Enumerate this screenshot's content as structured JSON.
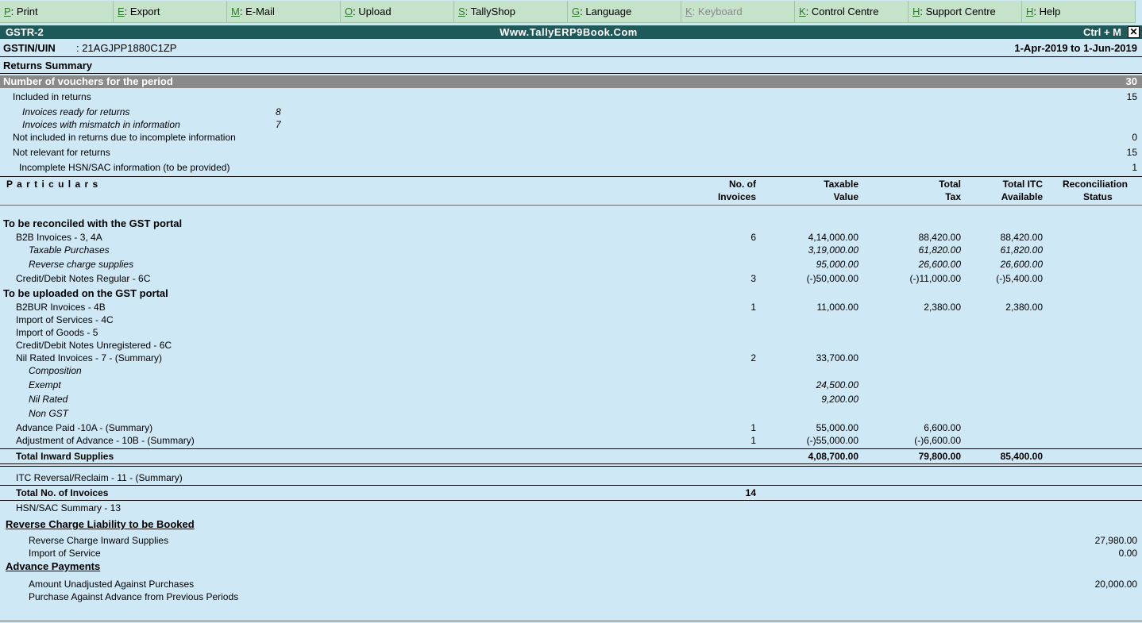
{
  "menu": [
    {
      "key": "P",
      "rest": ": Print",
      "disabled": false
    },
    {
      "key": "E",
      "rest": ": Export",
      "disabled": false
    },
    {
      "key": "M",
      "rest": ": E-Mail",
      "disabled": false
    },
    {
      "key": "O",
      "rest": ": Upload",
      "disabled": false
    },
    {
      "key": "S",
      "rest": ": TallyShop",
      "disabled": false
    },
    {
      "key": "G",
      "rest": ": Language",
      "disabled": false
    },
    {
      "key": "K",
      "rest": ": Keyboard",
      "disabled": true
    },
    {
      "key": "K",
      "rest": ": Control Centre",
      "disabled": false
    },
    {
      "key": "H",
      "rest": ": Support Centre",
      "disabled": false
    },
    {
      "key": "H",
      "rest": ": Help",
      "disabled": false
    }
  ],
  "titlebar": {
    "left": "GSTR-2",
    "center": "Www.TallyERP9Book.Com",
    "right": "Ctrl + M",
    "close": "✕"
  },
  "header": {
    "gstin_label": "GSTIN/UIN",
    "gstin_value": ": 21AGJPP1880C1ZP",
    "period": "1-Apr-2019 to 1-Jun-2019"
  },
  "summary": {
    "title": "Returns Summary",
    "vouchers_label": "Number of vouchers for the period",
    "vouchers_value": "30",
    "included_label": "Included in returns",
    "included_value": "15",
    "ready_label": "Invoices ready for returns",
    "ready_value": "8",
    "mismatch_label": "Invoices with mismatch in information",
    "mismatch_value": "7",
    "notincl_label": "Not included in returns due to incomplete information",
    "notincl_value": "0",
    "notrel_label": "Not relevant for returns",
    "notrel_value": "15",
    "hsn_label": "Incomplete HSN/SAC information (to be provided)",
    "hsn_value": "1"
  },
  "columns": {
    "particulars": "P a r t i c u l a r s",
    "noinv1": "No. of",
    "noinv2": "Invoices",
    "taxable1": "Taxable",
    "taxable2": "Value",
    "tax1": "Total",
    "tax2": "Tax",
    "itc1": "Total ITC",
    "itc2": "Available",
    "rec1": "Reconciliation",
    "rec2": "Status"
  },
  "rows": {
    "sec1": "To be reconciled with the GST portal",
    "b2b": {
      "label": "B2B Invoices - 3, 4A",
      "inv": "6",
      "taxable": "4,14,000.00",
      "tax": "88,420.00",
      "itc": "88,420.00"
    },
    "taxable_purch": {
      "label": "Taxable Purchases",
      "taxable": "3,19,000.00",
      "tax": "61,820.00",
      "itc": "61,820.00"
    },
    "rcm": {
      "label": "Reverse charge supplies",
      "taxable": "95,000.00",
      "tax": "26,600.00",
      "itc": "26,600.00"
    },
    "cdn": {
      "label": "Credit/Debit Notes Regular - 6C",
      "inv": "3",
      "taxable": "(-)50,000.00",
      "tax": "(-)11,000.00",
      "itc": "(-)5,400.00"
    },
    "sec2": "To be uploaded on the GST portal",
    "b2bur": {
      "label": "B2BUR Invoices - 4B",
      "inv": "1",
      "taxable": "11,000.00",
      "tax": "2,380.00",
      "itc": "2,380.00"
    },
    "imp_serv": {
      "label": "Import of Services - 4C"
    },
    "imp_goods": {
      "label": "Import of Goods - 5"
    },
    "cdnur": {
      "label": "Credit/Debit Notes Unregistered - 6C"
    },
    "nil": {
      "label": "Nil Rated Invoices - 7 - (Summary)",
      "inv": "2",
      "taxable": "33,700.00"
    },
    "composition": {
      "label": "Composition"
    },
    "exempt": {
      "label": "Exempt",
      "taxable": "24,500.00"
    },
    "nilrated": {
      "label": "Nil Rated",
      "taxable": "9,200.00"
    },
    "nongst": {
      "label": "Non GST"
    },
    "adv_paid": {
      "label": "Advance Paid -10A - (Summary)",
      "inv": "1",
      "taxable": "55,000.00",
      "tax": "6,600.00"
    },
    "adj_adv": {
      "label": "Adjustment of Advance - 10B - (Summary)",
      "inv": "1",
      "taxable": "(-)55,000.00",
      "tax": "(-)6,600.00"
    },
    "total_inward": {
      "label": "Total Inward Supplies",
      "taxable": "4,08,700.00",
      "tax": "79,800.00",
      "itc": "85,400.00"
    },
    "itc_rev": {
      "label": "ITC Reversal/Reclaim - 11 - (Summary)"
    },
    "total_inv": {
      "label": "Total No. of Invoices",
      "inv": "14"
    },
    "hsn_sum": {
      "label": "HSN/SAC Summary - 13"
    }
  },
  "rcl": {
    "title": "Reverse Charge Liability to be Booked",
    "rcm_inward_label": "Reverse Charge Inward Supplies",
    "rcm_inward_value": "27,980.00",
    "imp_serv_label": "Import of Service",
    "imp_serv_value": "0.00"
  },
  "adv": {
    "title": "Advance Payments",
    "unadj_label": "Amount Unadjusted Against Purchases",
    "unadj_value": "20,000.00",
    "prev_label": "Purchase Against Advance from Previous Periods"
  }
}
